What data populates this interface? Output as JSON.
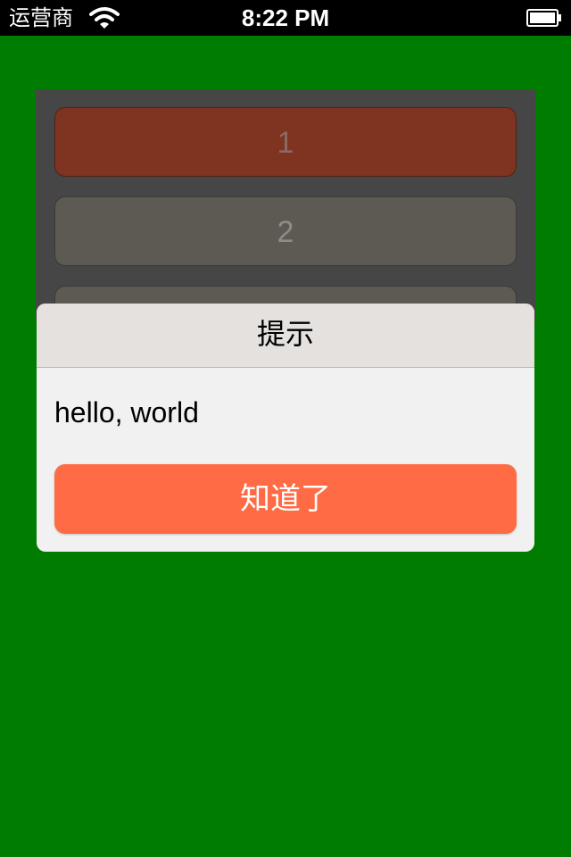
{
  "status_bar": {
    "carrier": "运营商",
    "time": "8:22 PM",
    "wifi_icon": "wifi-icon",
    "battery_icon": "battery-icon"
  },
  "panel": {
    "buttons": [
      {
        "label": "1",
        "color": "#7f3321"
      },
      {
        "label": "2",
        "color": "#5d5a53"
      },
      {
        "label": "",
        "color": "#5d5a53"
      }
    ]
  },
  "dialog": {
    "title": "提示",
    "message": "hello, world",
    "button_label": "知道了",
    "button_color": "#ff6b45"
  },
  "colors": {
    "background": "#007c00",
    "panel": "#464646",
    "dialog_header": "#e4e1df"
  }
}
